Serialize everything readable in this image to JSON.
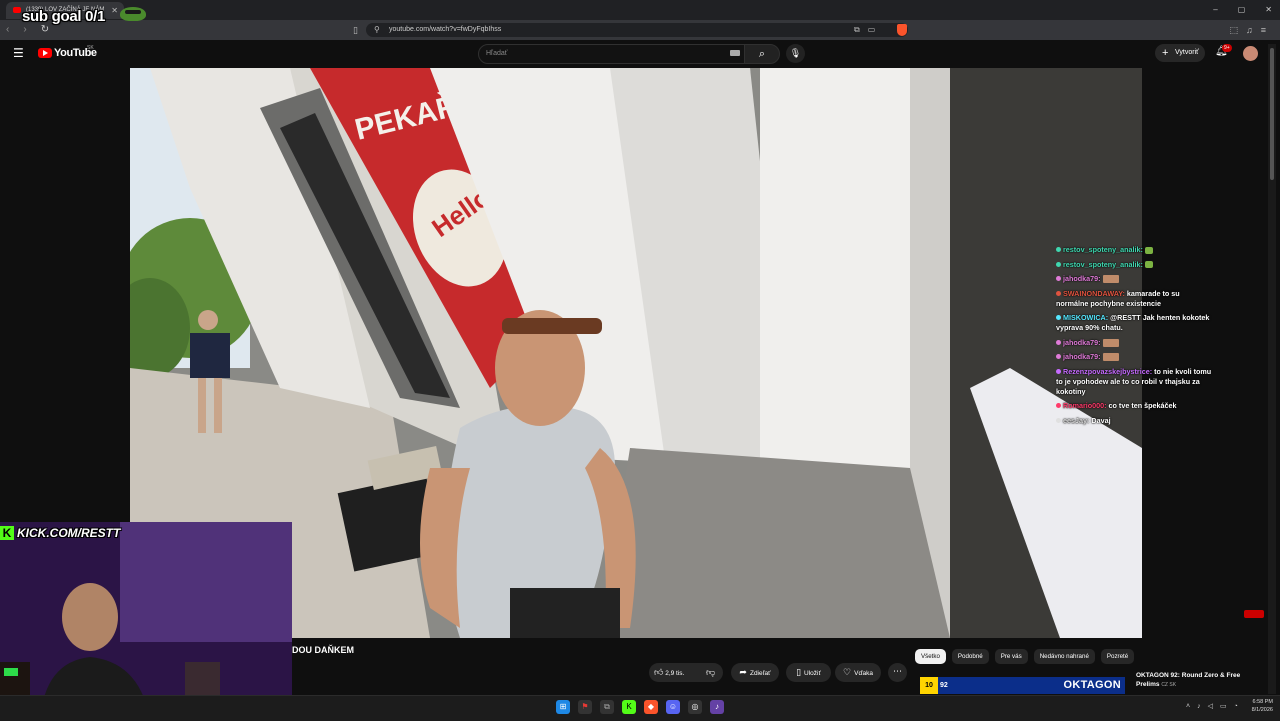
{
  "browser": {
    "tab_title": "(1339) LOV ZAČÍNÁ JE NÁM",
    "url": "youtube.com/watch?v=fwDyFqbIhss",
    "window_controls": [
      "–",
      "▢",
      "✕"
    ]
  },
  "overlay": {
    "sub_goal": "sub goal 0/1",
    "kick_url": "KICK.COM/RESTT",
    "kick_logo": "K"
  },
  "youtube": {
    "logo_text": "YouTube",
    "country": "SK",
    "search_placeholder": "Hľadať",
    "create_label": "Vytvoriť",
    "notifications_badge": "9+"
  },
  "video": {
    "title_fragment": "DOU DAŇKEM",
    "likes": "2,9 tis.",
    "share_label": "Zdieľať",
    "save_label": "Uložiť",
    "thanks_label": "Vďaka"
  },
  "chat": [
    {
      "user": "restov_spoteny_analik:",
      "user_color": "#3fd8b0",
      "text": "",
      "emote": "green"
    },
    {
      "user": "restov_spoteny_analik:",
      "user_color": "#3fd8b0",
      "text": "",
      "emote": "green"
    },
    {
      "user": "jahodka79:",
      "user_color": "#e07bd8",
      "text": "",
      "emote": "image"
    },
    {
      "user": "SWAINONDAWAY:",
      "user_color": "#e0533f",
      "text": "kamarade to su normálne pochybne existencie",
      "emote": ""
    },
    {
      "user": "MISKOWICA:",
      "user_color": "#56e8ff",
      "text": "@RESTT Jak henten kokotek vyprava 90% chatu.",
      "emote": ""
    },
    {
      "user": "jahodka79:",
      "user_color": "#e07bd8",
      "text": "",
      "emote": "image"
    },
    {
      "user": "jahodka79:",
      "user_color": "#e07bd8",
      "text": "",
      "emote": "image"
    },
    {
      "user": "Rezenzpovazskejbystrice:",
      "user_color": "#c66bff",
      "text": "to nie kvoli tomu to je vpohodew ale to co robil v thajsku za kokotiny",
      "emote": ""
    },
    {
      "user": "Romario000:",
      "user_color": "#ff3b6b",
      "text": "co tve ten špekáček",
      "emote": ""
    },
    {
      "user": "eesJay:",
      "user_color": "#e0e0e0",
      "text": "Davaj",
      "emote": ""
    }
  ],
  "chips": [
    "Všetko",
    "Podobné",
    "Pre vás",
    "Nedávno nahrané",
    "Pozreté"
  ],
  "recommendation": {
    "badge": "10",
    "count": "92",
    "brand": "OKTAGON",
    "title": "OKTAGON 92: Round Zero & Free Prelims",
    "sub": "CZ SK"
  },
  "taskbar": {
    "time": "6:58 PM",
    "date": "8/1/2026"
  },
  "colors": {
    "youtube_red": "#ff0000",
    "kick_green": "#53fc18",
    "chip_active": "#f1f1f1"
  }
}
